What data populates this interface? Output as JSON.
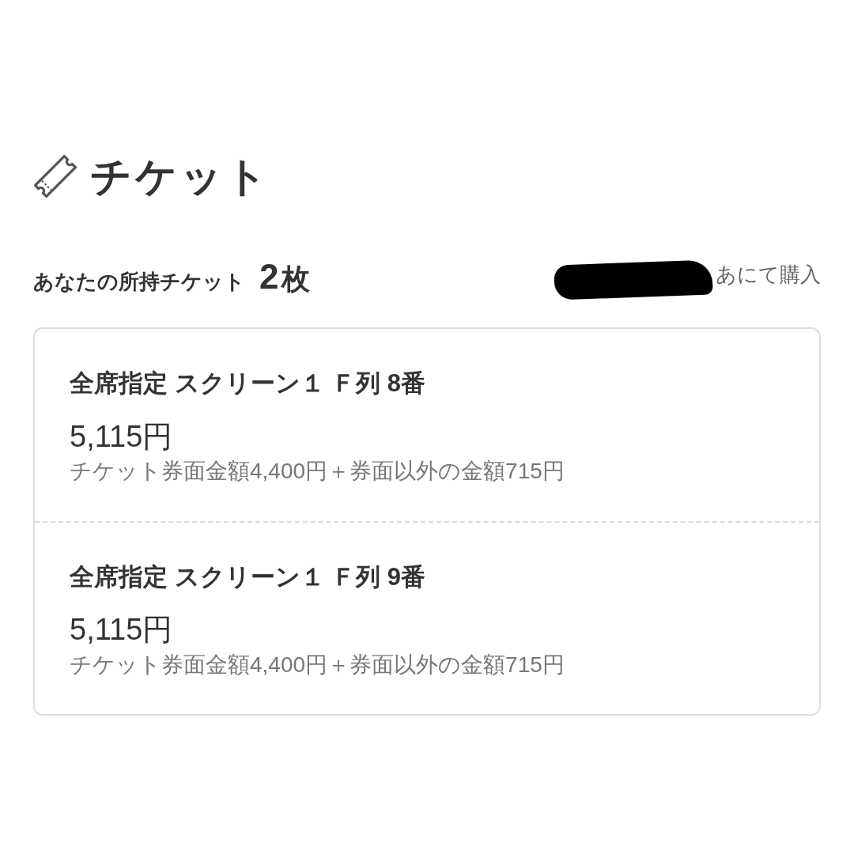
{
  "header": {
    "title": "チケット"
  },
  "summary": {
    "label": "あなたの所持チケット",
    "count": "2",
    "unit": "枚",
    "purchase_note": "あにて購入"
  },
  "tickets": [
    {
      "seat": "全席指定 スクリーン１ Ｆ列 8番",
      "price": "5,115円",
      "breakdown": "チケット券面金額4,400円＋券面以外の金額715円"
    },
    {
      "seat": "全席指定 スクリーン１ Ｆ列 9番",
      "price": "5,115円",
      "breakdown": "チケット券面金額4,400円＋券面以外の金額715円"
    }
  ]
}
